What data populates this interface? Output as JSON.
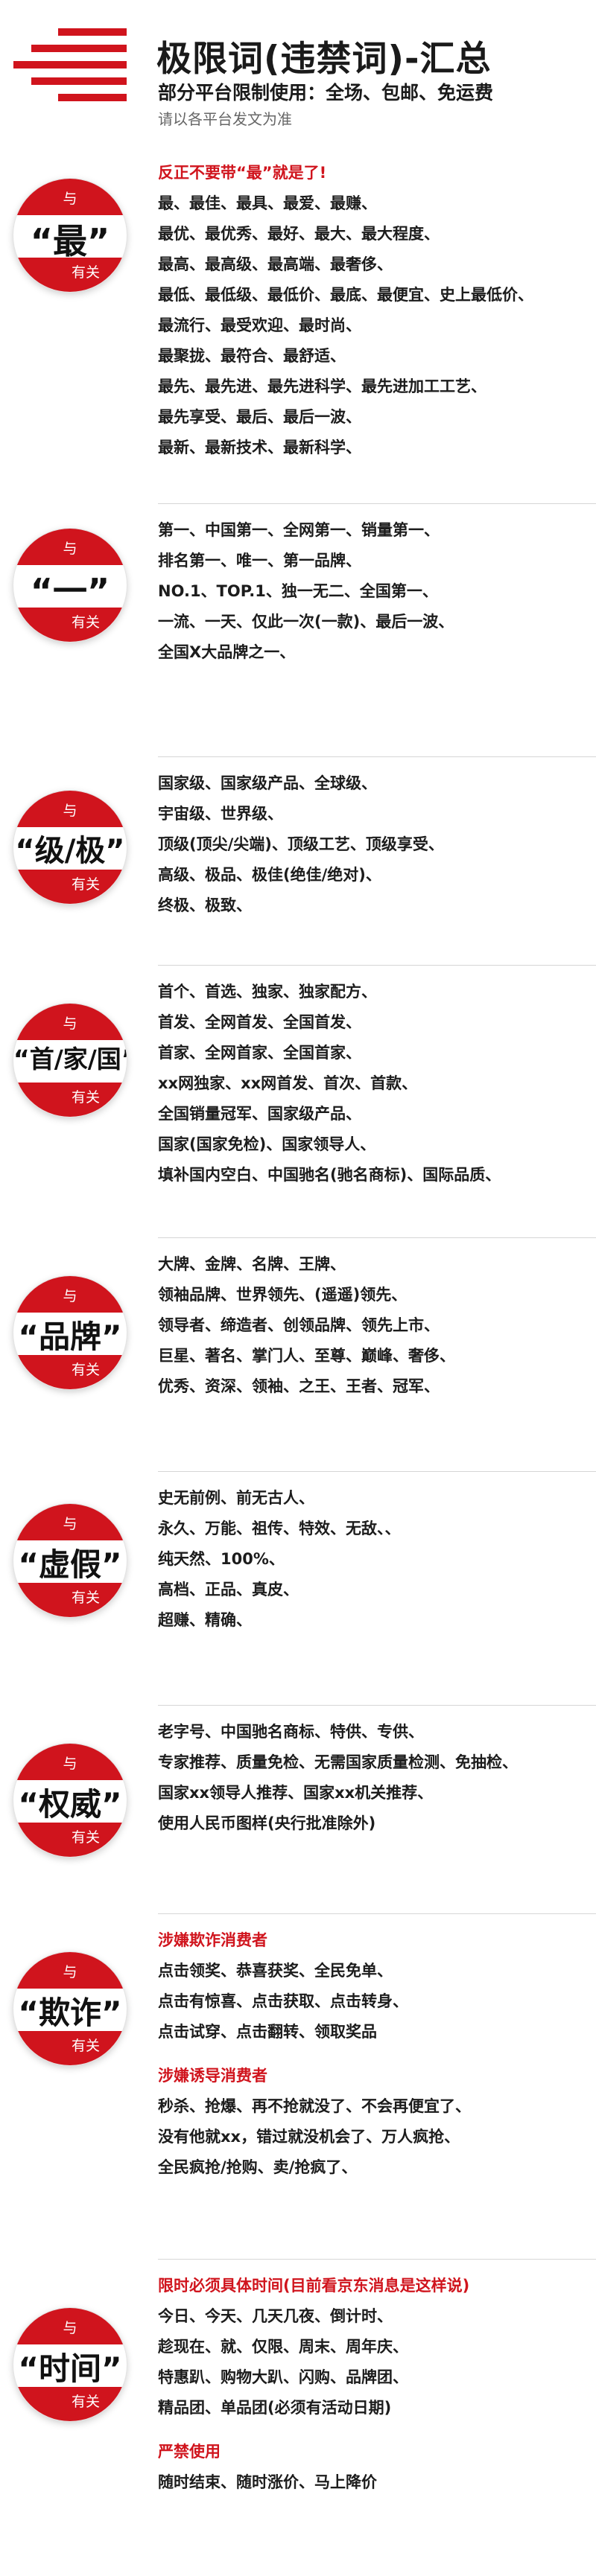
{
  "header": {
    "title": "极限词(违禁词)-汇总",
    "subtitle": "部分平台限制使用：全场、包邮、免运费",
    "note": "请以各平台发文为准"
  },
  "badge_top": "与",
  "badge_bottom": "有关",
  "sections": [
    {
      "key": "“最”",
      "lines": [
        {
          "text": "反正不要带“最”就是了!",
          "style": "red"
        },
        {
          "text": "最、最佳、最具、最爱、最赚、"
        },
        {
          "text": "最优、最优秀、最好、最大、最大程度、"
        },
        {
          "text": "最高、最高级、最高端、最奢侈、"
        },
        {
          "text": "最低、最低级、最低价、最底、最便宜、史上最低价、"
        },
        {
          "text": "最流行、最受欢迎、最时尚、"
        },
        {
          "text": "最聚拢、最符合、最舒适、"
        },
        {
          "text": "最先、最先进、最先进科学、最先进加工工艺、"
        },
        {
          "text": "最先享受、最后、最后一波、"
        },
        {
          "text": "最新、最新技术、最新科学、"
        }
      ]
    },
    {
      "key": "“一”",
      "lines": [
        {
          "text": "第一、中国第一、全网第一、销量第一、"
        },
        {
          "text": "排名第一、唯一、第一品牌、"
        },
        {
          "text": "NO.1、TOP.1、独一无二、全国第一、"
        },
        {
          "text": "一流、一天、仅此一次(一款)、最后一波、"
        },
        {
          "text": "全国X大品牌之一、"
        }
      ]
    },
    {
      "key": "“级/极”",
      "lines": [
        {
          "text": "国家级、国家级产品、全球级、"
        },
        {
          "text": "宇宙级、世界级、"
        },
        {
          "text": "顶级(顶尖/尖端)、顶级工艺、顶级享受、"
        },
        {
          "text": "高级、极品、极佳(绝佳/绝对)、"
        },
        {
          "text": "终极、极致、"
        }
      ]
    },
    {
      "key": "“首/家/国”",
      "lines": [
        {
          "text": "首个、首选、独家、独家配方、"
        },
        {
          "text": "首发、全网首发、全国首发、"
        },
        {
          "text": "首家、全网首家、全国首家、"
        },
        {
          "text": "xx网独家、xx网首发、首次、首款、"
        },
        {
          "text": "全国销量冠军、国家级产品、"
        },
        {
          "text": "国家(国家免检)、国家领导人、"
        },
        {
          "text": "填补国内空白、中国驰名(驰名商标)、国际品质、"
        }
      ]
    },
    {
      "key": "“品牌”",
      "lines": [
        {
          "text": "大牌、金牌、名牌、王牌、"
        },
        {
          "text": "领袖品牌、世界领先、(遥遥)领先、"
        },
        {
          "text": "领导者、缔造者、创领品牌、领先上市、"
        },
        {
          "text": "巨星、著名、掌门人、至尊、巅峰、奢侈、"
        },
        {
          "text": "优秀、资深、领袖、之王、王者、冠军、"
        }
      ]
    },
    {
      "key": "“虚假”",
      "lines": [
        {
          "text": "史无前例、前无古人、"
        },
        {
          "text": "永久、万能、祖传、特效、无敌、、"
        },
        {
          "text": "纯天然、100%、"
        },
        {
          "text": "高档、正品、真皮、"
        },
        {
          "text": "超赚、精确、"
        }
      ]
    },
    {
      "key": "“权威”",
      "lines": [
        {
          "text": "老字号、中国驰名商标、特供、专供、"
        },
        {
          "text": "专家推荐、质量免检、无需国家质量检测、免抽检、"
        },
        {
          "text": "国家xx领导人推荐、国家xx机关推荐、"
        },
        {
          "text": "使用人民币图样(央行批准除外)"
        }
      ]
    },
    {
      "key": "“欺诈”",
      "lines": [
        {
          "text": "涉嫌欺诈消费者",
          "style": "sub"
        },
        {
          "text": "点击领奖、恭喜获奖、全民免单、"
        },
        {
          "text": "点击有惊喜、点击获取、点击转身、"
        },
        {
          "text": "点击试穿、点击翻转、领取奖品"
        },
        {
          "text": "",
          "style": "gap"
        },
        {
          "text": "涉嫌诱导消费者",
          "style": "sub"
        },
        {
          "text": "秒杀、抢爆、再不抢就没了、不会再便宜了、"
        },
        {
          "text": "没有他就xx，错过就没机会了、万人疯抢、"
        },
        {
          "text": "全民疯抢/抢购、卖/抢疯了、"
        }
      ]
    },
    {
      "key": "“时间”",
      "lines": [
        {
          "text": "限时必须具体时间(目前看京东消息是这样说)",
          "style": "sub"
        },
        {
          "text": "今日、今天、几天几夜、倒计时、"
        },
        {
          "text": "趁现在、就、仅限、周末、周年庆、"
        },
        {
          "text": "特惠趴、购物大趴、闪购、品牌团、"
        },
        {
          "text": "精品团、单品团(必须有活动日期)"
        },
        {
          "text": "",
          "style": "gap"
        },
        {
          "text": "严禁使用",
          "style": "sub"
        },
        {
          "text": "随时结束、随时涨价、马上降价"
        }
      ]
    }
  ]
}
